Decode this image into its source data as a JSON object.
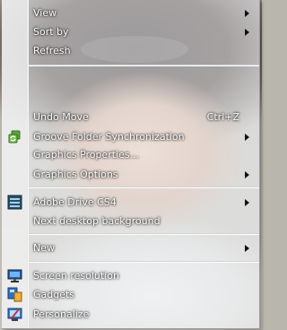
{
  "context_menu": {
    "items": [
      {
        "label": "View",
        "has_submenu": true
      },
      {
        "label": "Sort by",
        "has_submenu": true
      },
      {
        "label": "Refresh"
      },
      {
        "label": "Undo Move",
        "shortcut": "Ctrl+Z"
      },
      {
        "label": "Groove Folder Synchronization",
        "has_submenu": true,
        "icon": "groove-sync-icon"
      },
      {
        "label": "Graphics Properties..."
      },
      {
        "label": "Graphics Options",
        "has_submenu": true
      },
      {
        "label": "Adobe Drive CS4",
        "has_submenu": true,
        "icon": "adobe-drive-icon"
      },
      {
        "label": "Next desktop background"
      },
      {
        "label": "New",
        "has_submenu": true
      },
      {
        "label": "Screen resolution",
        "icon": "monitor-icon"
      },
      {
        "label": "Gadgets",
        "icon": "gadgets-icon"
      },
      {
        "label": "Personalize",
        "icon": "personalize-icon"
      }
    ]
  }
}
